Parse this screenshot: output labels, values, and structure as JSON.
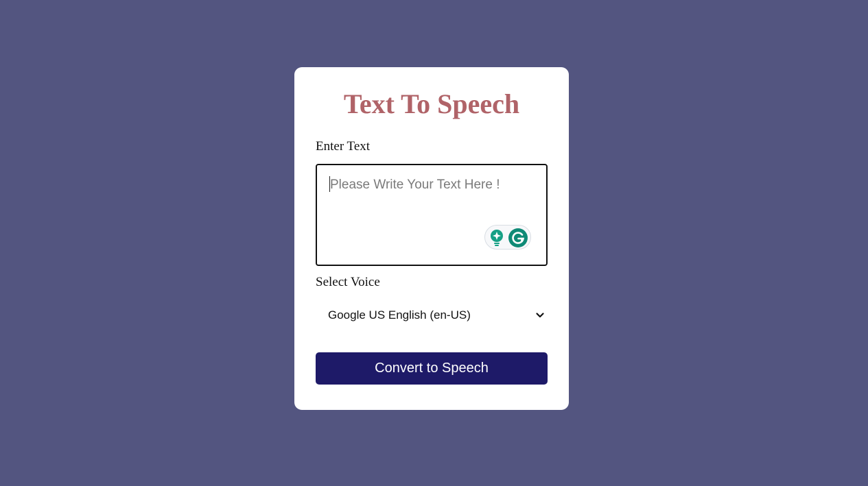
{
  "theme": {
    "background": "#535580",
    "card": "#ffffff",
    "title_color": "#b06368",
    "button_color": "#1e1a68",
    "grammar_accent": "#16a085"
  },
  "app": {
    "title": "Text To Speech"
  },
  "form": {
    "text_label": "Enter Text",
    "text_value": "",
    "text_placeholder": "Please Write Your Text Here !",
    "voice_label": "Select Voice",
    "voice_selected": "Google US English (en-US)",
    "convert_label": "Convert to Speech"
  },
  "icons": {
    "assistant": "lightbulb-icon",
    "grammar": "grammarly-g-icon",
    "dropdown": "chevron-down-icon"
  }
}
